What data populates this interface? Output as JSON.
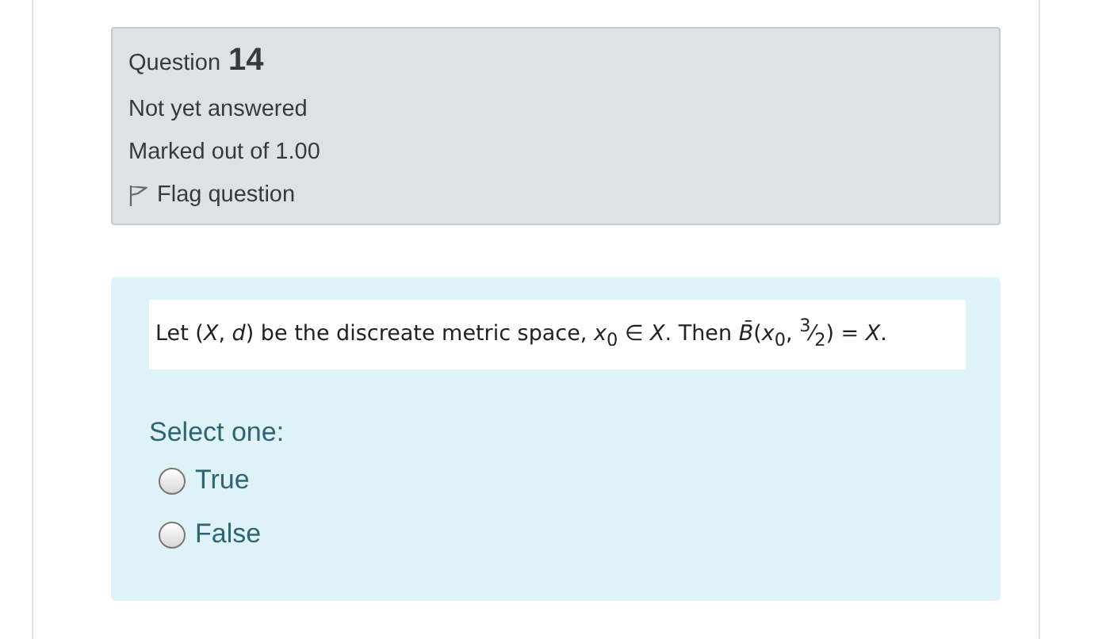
{
  "info": {
    "question_label": "Question",
    "question_number": "14",
    "state": "Not yet answered",
    "marks": "Marked out of 1.00",
    "flag": {
      "label": "Flag question",
      "flagged": false
    }
  },
  "question": {
    "text": "Let (*X*, *d*) be the discreate metric space, *x*$_{0}$ ∈ *X*.  Then  *B̄*(*x*$_{0}$, $^{3}$⁄$_{2}$) = *X*.",
    "prompt": "Select one:",
    "options": [
      {
        "label": "True",
        "selected": false
      },
      {
        "label": "False",
        "selected": false
      }
    ]
  }
}
